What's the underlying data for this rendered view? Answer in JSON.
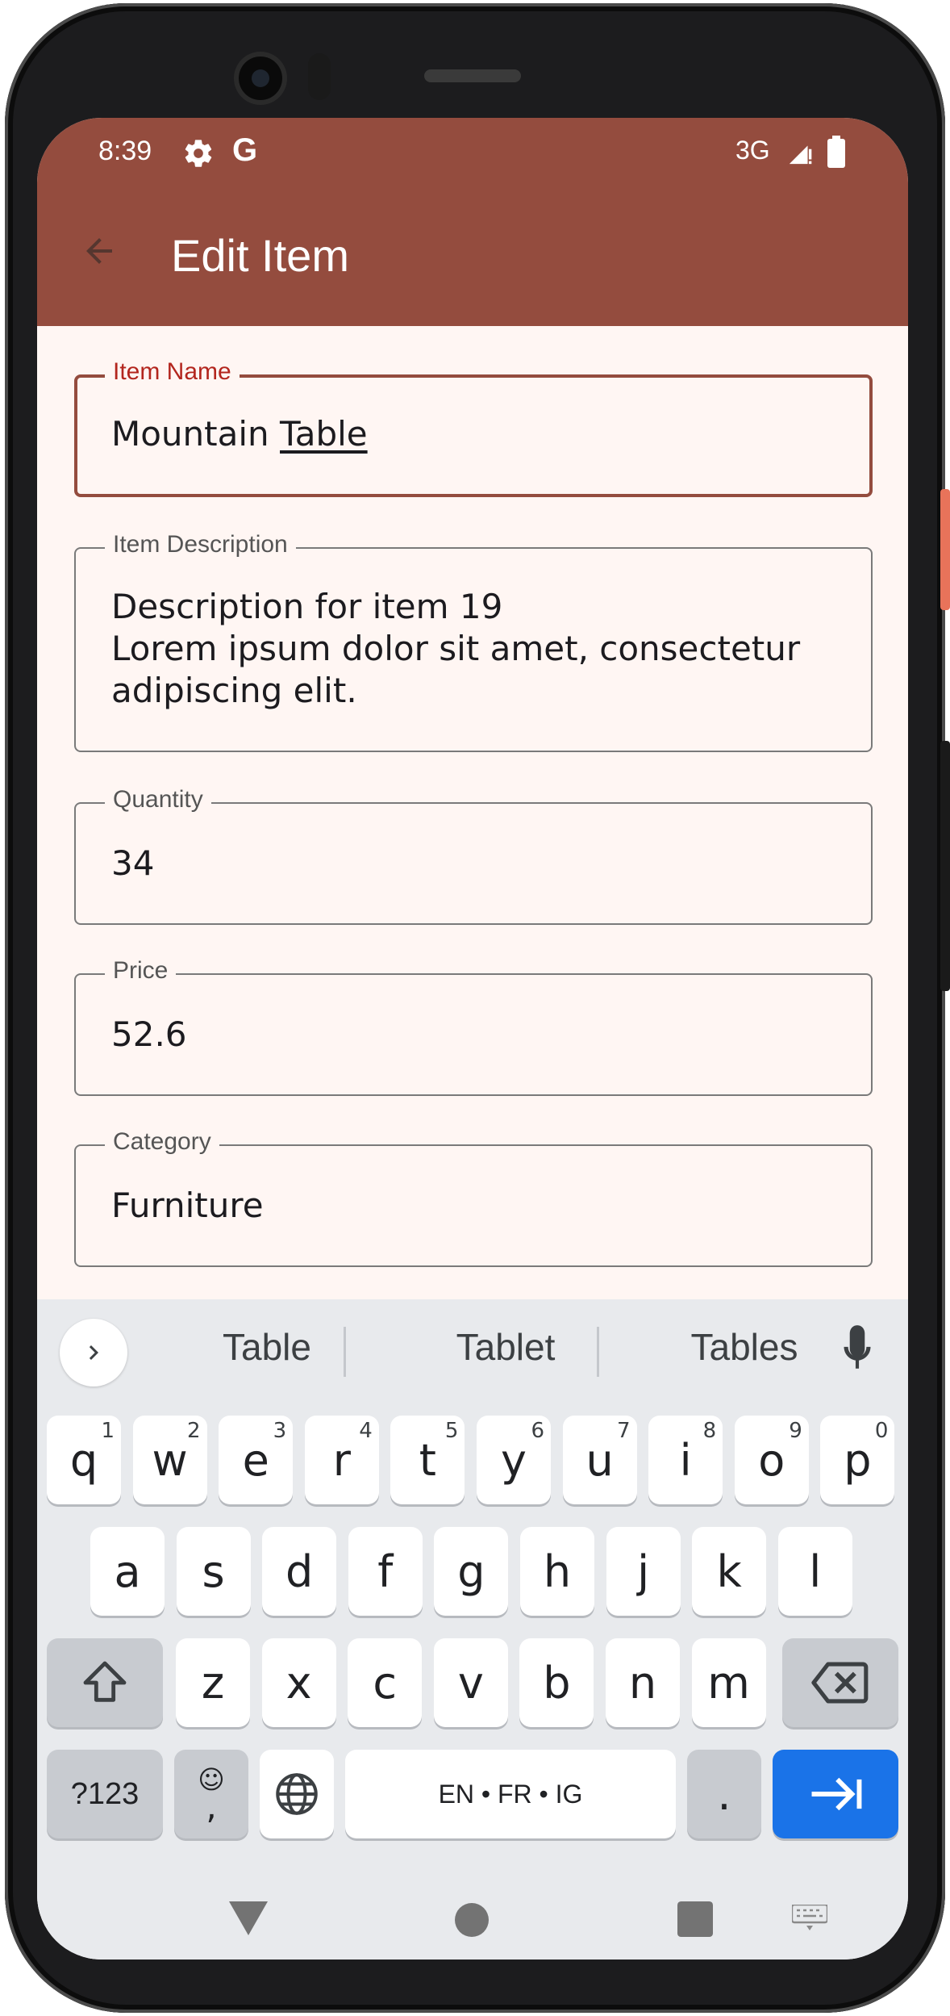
{
  "status_bar": {
    "time": "8:39",
    "google_icon_text": "G",
    "network": "3G",
    "icons": [
      "settings-gear-icon",
      "google-icon",
      "cell-signal-icon",
      "battery-icon"
    ]
  },
  "app_bar": {
    "title": "Edit Item",
    "back_icon": "arrow-back-icon",
    "color": "#944c3e"
  },
  "form": {
    "item_name": {
      "label": "Item Name",
      "value_prefix": "Mountain ",
      "value_composing": "Table"
    },
    "item_description": {
      "label": "Item Description",
      "value": "Description for item 19\nLorem ipsum dolor sit amet, consectetur\nadipiscing elit."
    },
    "quantity": {
      "label": "Quantity",
      "value": "34"
    },
    "price": {
      "label": "Price",
      "value": "52.6"
    },
    "category": {
      "label": "Category",
      "value": "Furniture"
    }
  },
  "keyboard": {
    "suggestions": [
      "Table",
      "Tablet",
      "Tables"
    ],
    "row1": [
      {
        "k": "q",
        "h": "1"
      },
      {
        "k": "w",
        "h": "2"
      },
      {
        "k": "e",
        "h": "3"
      },
      {
        "k": "r",
        "h": "4"
      },
      {
        "k": "t",
        "h": "5"
      },
      {
        "k": "y",
        "h": "6"
      },
      {
        "k": "u",
        "h": "7"
      },
      {
        "k": "i",
        "h": "8"
      },
      {
        "k": "o",
        "h": "9"
      },
      {
        "k": "p",
        "h": "0"
      }
    ],
    "row2": [
      "a",
      "s",
      "d",
      "f",
      "g",
      "h",
      "j",
      "k",
      "l"
    ],
    "row3": [
      "z",
      "x",
      "c",
      "v",
      "b",
      "n",
      "m"
    ],
    "symbols_label": "?123",
    "emoji_comma_top": "☺",
    "emoji_comma_bottom": ",",
    "space_label": "EN • FR • IG",
    "period_label": ".",
    "accent_color": "#1a73e8"
  },
  "navigation_bar": {
    "icons": [
      "back-triangle-icon",
      "home-circle-icon",
      "recents-square-icon",
      "keyboard-switch-icon"
    ]
  }
}
